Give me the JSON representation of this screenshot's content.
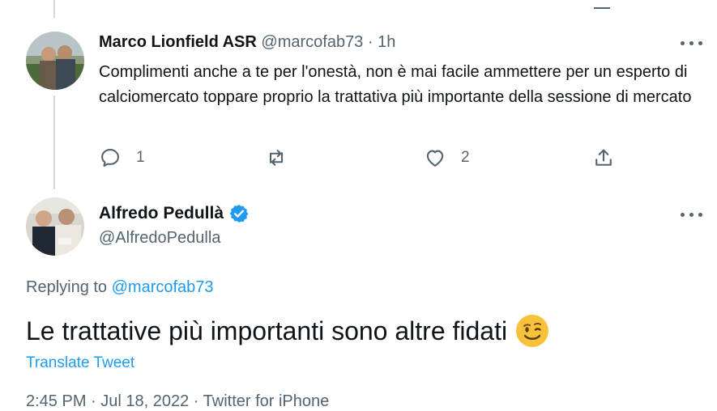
{
  "reply": {
    "display_name": "Marco Lionfield ASR",
    "handle": "@marcofab73",
    "time": "1h",
    "text": "Complimenti anche a te per l'onestà, non è mai facile ammettere per un esperto di calciomercato toppare proprio la trattativa più importante della sessione di mercato",
    "reply_count": "1",
    "like_count": "2"
  },
  "main": {
    "display_name": "Alfredo Pedullà",
    "handle": "@AlfredoPedulla",
    "replying_prefix": "Replying to",
    "replying_to": "@marcofab73",
    "text": "Le trattative più importanti sono altre fidati",
    "emoji": "winking-face",
    "translate_label": "Translate Tweet",
    "footer": "2:45 PM · Jul 18, 2022 · Twitter for iPhone"
  },
  "colors": {
    "text": "#0f1419",
    "secondary": "#536471",
    "accent": "#1d9bf0",
    "thread_line": "#cfd9de"
  },
  "icons": [
    "reply-icon",
    "retweet-icon",
    "like-icon",
    "share-icon",
    "more-icon",
    "verified-badge-icon"
  ]
}
